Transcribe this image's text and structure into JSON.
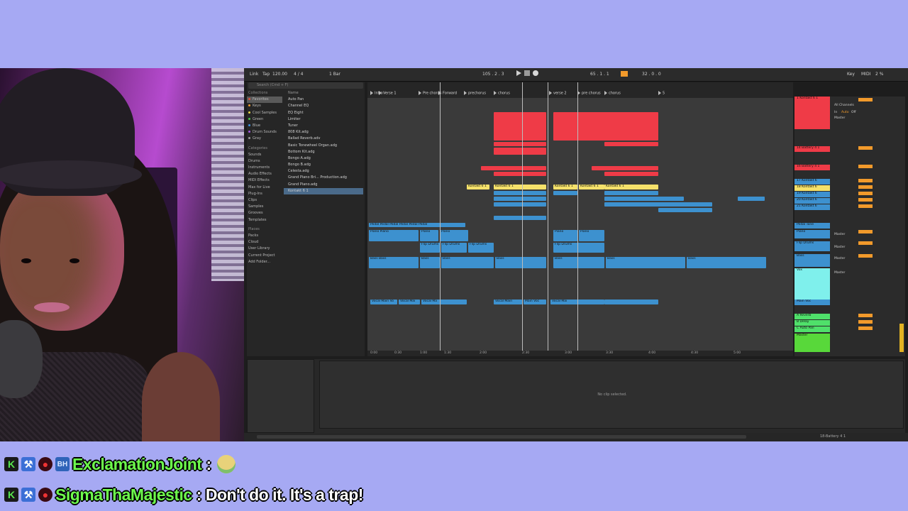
{
  "daw": {
    "topbar": {
      "link": "Link",
      "tap": "Tap",
      "tempo": "120.00",
      "meter": "4 / 4",
      "quant": "1 Bar",
      "position": "105 . 2 . 3",
      "loop_start": "65 . 1 . 1",
      "loop_len": "32 . 0 . 0",
      "key": "Key",
      "midi": "MIDI",
      "cpu": "2 %"
    },
    "browser": {
      "search_placeholder": "Search (Cmd + F)",
      "collections_header": "Collections",
      "collections": [
        {
          "label": "Favorites",
          "color": "#e0533f",
          "selected": true
        },
        {
          "label": "Keys",
          "color": "#f29a2b"
        },
        {
          "label": "Cool Samples",
          "color": "#e7d94a"
        },
        {
          "label": "Green",
          "color": "#4bc34b"
        },
        {
          "label": "Blue",
          "color": "#3d8fe0"
        },
        {
          "label": "Drum Sounds",
          "color": "#a35ae0"
        },
        {
          "label": "Gray",
          "color": "#9a9a9a"
        }
      ],
      "categories_header": "Categories",
      "categories": [
        "Sounds",
        "Drums",
        "Instruments",
        "Audio Effects",
        "MIDI Effects",
        "Max for Live",
        "Plug-Ins",
        "Clips",
        "Samples",
        "Grooves",
        "Templates"
      ],
      "places_header": "Places",
      "places": [
        "Packs",
        "Cloud",
        "User Library",
        "Current Project",
        "Add Folder..."
      ],
      "name_header": "Name",
      "files": [
        "Auto Pan",
        "Channel EQ",
        "EQ Eight",
        "Limiter",
        "Tuner",
        "808 Kit.adg",
        "Ballad Reverb.adv",
        "Basic Tonewheel Organ.adg",
        "Bottom Kit.adg",
        "Bongo A.adg",
        "Bongo B.adg",
        "Celesta.adg",
        "Grand Piano Bri... Production.adg",
        "Grand Piano.adg",
        "Kontakt 6 1"
      ]
    },
    "arrangement": {
      "locators": [
        "Intro",
        "Verse 1",
        "Pre chorus",
        "Forward",
        "prechorus",
        "chorus",
        "verse 2",
        "pre chorus",
        "chorus",
        "5"
      ],
      "clips": {
        "kontakt_a": "Kontakt 6 1",
        "kontakt_b": "Kontakt 6 1",
        "kontakt_c": "Kontakt 6 1",
        "kontakt_d": "Kontakt 6 1",
        "kontakt_e": "Kontakt 6 1",
        "piano_a": "Piano Piano",
        "piano_b": "Piano",
        "piano_c": "Piano",
        "piano_d": "Piano",
        "piano_e": "Piano",
        "flip_a": "Flip Drums",
        "flip_b": "Flip Drums",
        "flip_c": "Flip Drums",
        "flip_d": "Flip Drums",
        "bass_a": "Bass Bass",
        "bass_b": "Bass",
        "bass_c": "Bass",
        "bass_d": "Bass",
        "bass_e": "Bass",
        "bass_f": "Bass",
        "bass_g": "Bass",
        "vocal_a": "Vocal Main Vo",
        "vocal_b": "Vocal Mai",
        "vocal_c": "Vocal Ma",
        "vocal_d": "Vocal Main",
        "vocal_e": "Main Voc",
        "vocal_f": "Vocal Mai",
        "pedal": "Pedal Pedal Pedal Pedal Pedal Pedal"
      },
      "time_labels": [
        "0:00",
        "0:30",
        "1:00",
        "1:30",
        "2:00",
        "2:30",
        "3:00",
        "3:30",
        "4:00",
        "4:30",
        "5:00"
      ]
    },
    "mixer": {
      "tracks": [
        {
          "label": "1 Kontakt 6 1",
          "color": "#ef3b47"
        },
        {
          "label": "14 Battery 4 1",
          "color": "#ef3b47"
        },
        {
          "label": "16 Battery 4 1",
          "color": "#ef3b47"
        },
        {
          "label": "17 Kontakt 6",
          "color": "#3d91cf"
        },
        {
          "label": "18 Kontakt 6",
          "color": "#f5e16a"
        },
        {
          "label": "19 Kontakt 6",
          "color": "#3d91cf"
        },
        {
          "label": "20 Kontakt 6",
          "color": "#3d91cf"
        },
        {
          "label": "21 Kontakt 6",
          "color": "#3d91cf"
        },
        {
          "label": "Pedal Tone",
          "color": "#3d91cf"
        },
        {
          "label": "Piano",
          "color": "#3d91cf"
        },
        {
          "label": "Flip Drums",
          "color": "#3d91cf"
        },
        {
          "label": "Bass",
          "color": "#3d91cf"
        },
        {
          "label": "Vox",
          "color": "#7ff0ec"
        },
        {
          "label": "Main Voc",
          "color": "#3d91cf"
        },
        {
          "label": "A Reverb",
          "color": "#4fe06a"
        },
        {
          "label": "B Delay",
          "color": "#4fe06a"
        },
        {
          "label": "C Auto Pan",
          "color": "#4fe06a"
        },
        {
          "label": "Master",
          "color": "#58d83a"
        }
      ],
      "io_all_channels": "All Channels",
      "io_master": "Master",
      "io_in": "In",
      "io_auto": "Auto",
      "io_off": "Off"
    },
    "detail": {
      "no_clip": "No clip selected."
    },
    "status": {
      "right_label": "18-Battery 4 1"
    }
  },
  "chat": [
    {
      "username": "ExclamationJoint",
      "separator": ":",
      "message": "",
      "has_emote": true,
      "badges": [
        "K",
        "tool",
        "circle",
        "bh"
      ]
    },
    {
      "username": "SigmaThaMajestic",
      "separator": ":",
      "message": "Don't do it. It's a trap!",
      "has_emote": false,
      "badges": [
        "K",
        "tool",
        "circle"
      ]
    }
  ],
  "colors": {
    "background": "#a6a9f3",
    "username": "#6dfa4c",
    "clip_red": "#ef3b47",
    "clip_blue": "#3d91cf",
    "clip_yellow": "#f5e16a",
    "accent_orange": "#f29a2b"
  }
}
